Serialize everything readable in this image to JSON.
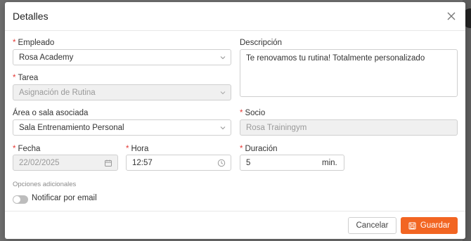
{
  "modal": {
    "title": "Detalles"
  },
  "form": {
    "empleado": {
      "label": "Empleado",
      "value": "Rosa Academy"
    },
    "tarea": {
      "label": "Tarea",
      "value": "Asignación de Rutina"
    },
    "area": {
      "label": "Área o sala asociada",
      "value": "Sala Entrenamiento Personal"
    },
    "descripcion": {
      "label": "Descripción",
      "value": "Te renovamos tu rutina! Totalmente personalizado"
    },
    "socio": {
      "label": "Socio",
      "value": "Rosa Trainingym"
    },
    "fecha": {
      "label": "Fecha",
      "value": "22/02/2025"
    },
    "hora": {
      "label": "Hora",
      "value": "12:57"
    },
    "duracion": {
      "label": "Duración",
      "value": "5",
      "unit": "min."
    }
  },
  "additional": {
    "caption": "Opciones adicionales",
    "notify_label": "Notificar por email",
    "notify_enabled": false
  },
  "footer": {
    "cancel_label": "Cancelar",
    "save_label": "Guardar"
  },
  "colors": {
    "accent": "#f26522",
    "required": "#e53935"
  },
  "icons": {
    "close": "close-icon",
    "calendar": "calendar-icon",
    "clock": "clock-icon",
    "chevron": "chevron-down-icon",
    "save": "save-icon"
  }
}
